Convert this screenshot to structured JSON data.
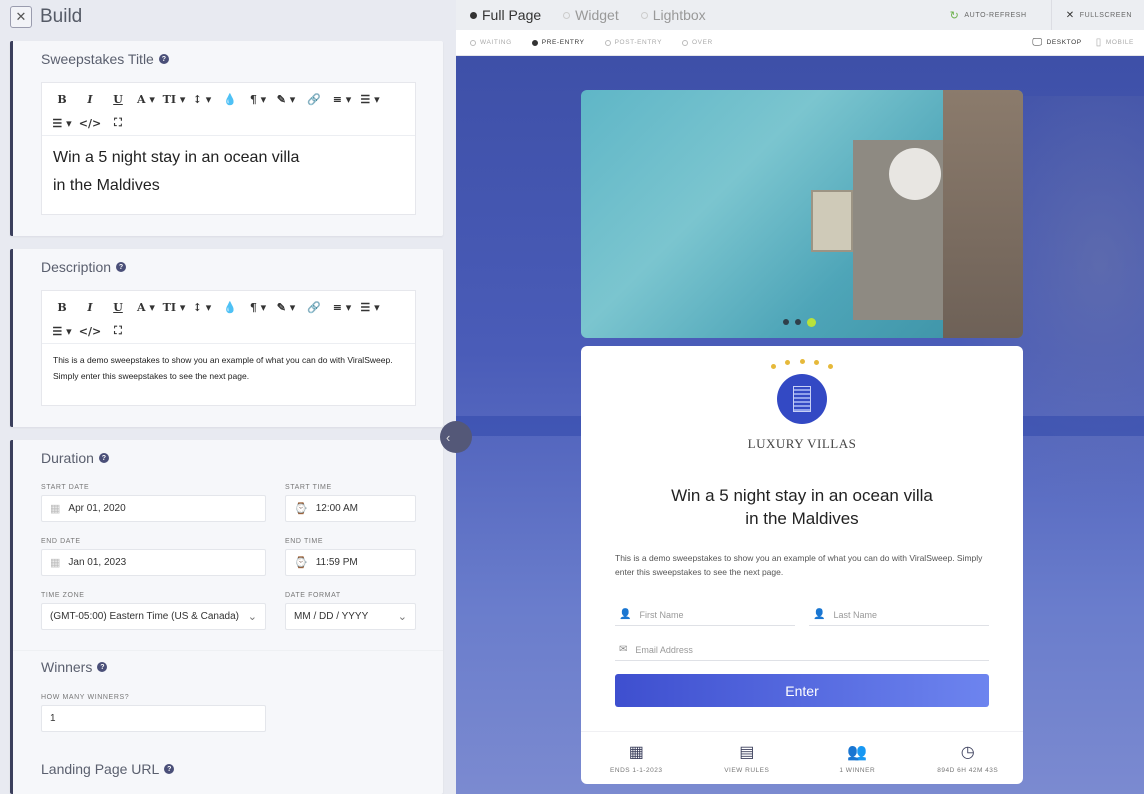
{
  "build": {
    "title": "Build",
    "icon": "tools-icon"
  },
  "title_section": {
    "label": "Sweepstakes Title",
    "toolbar": [
      "B",
      "I",
      "U",
      "A ▾",
      "TI ▾",
      "↕ ▾",
      "💧",
      "¶ ▾",
      "✎ ▾",
      "🔗",
      "≡ ▾",
      "☰ ▾",
      "☰ ▾",
      "</>",
      "⛶"
    ],
    "content_line1": "Win a 5 night stay in an ocean villa",
    "content_line2": "in the Maldives"
  },
  "description_section": {
    "label": "Description",
    "toolbar": [
      "B",
      "I",
      "U",
      "A ▾",
      "TI ▾",
      "↕ ▾",
      "💧",
      "¶ ▾",
      "✎ ▾",
      "🔗",
      "≡ ▾",
      "☰ ▾",
      "☰ ▾",
      "</>",
      "⛶"
    ],
    "content": "This is a demo sweepstakes to show you an example of what you can do with ViralSweep. Simply enter this sweepstakes to see the next page."
  },
  "duration": {
    "label": "Duration",
    "start_date_label": "Start Date",
    "start_date": "Apr 01, 2020",
    "start_time_label": "Start Time",
    "start_time": "12:00 AM",
    "end_date_label": "End Date",
    "end_date": "Jan 01, 2023",
    "end_time_label": "End Time",
    "end_time": "11:59 PM",
    "timezone_label": "Time Zone",
    "timezone": "(GMT-05:00) Eastern Time (US & Canada)",
    "date_format_label": "Date Format",
    "date_format": "MM / DD / YYYY"
  },
  "winners": {
    "label": "Winners",
    "count_label": "How many winners?",
    "count": "1"
  },
  "landing": {
    "label": "Landing Page URL"
  },
  "preview": {
    "modes": [
      "Full Page",
      "Widget",
      "Lightbox"
    ],
    "active_mode": "Full Page",
    "auto_refresh": "Auto-Refresh",
    "fullscreen": "Fullscreen",
    "states": [
      "Waiting",
      "Pre-Entry",
      "Post-Entry",
      "Over"
    ],
    "active_state": "Pre-Entry",
    "desktop": "Desktop",
    "mobile": "Mobile"
  },
  "campaign": {
    "brand": "LUXURY VILLAS",
    "headline1": "Win a 5 night stay in an ocean villa",
    "headline2": "in the Maldives",
    "description": "This is a demo sweepstakes to show you an example of what you can do with ViralSweep. Simply enter this sweepstakes to see the next page.",
    "first_name_placeholder": "First Name",
    "last_name_placeholder": "Last Name",
    "email_placeholder": "Email Address",
    "enter_label": "Enter",
    "slides": 3,
    "active_slide": 3,
    "footer": [
      {
        "icon": "calendar-icon",
        "label": "Ends 1-1-2023"
      },
      {
        "icon": "rules-icon",
        "label": "View Rules"
      },
      {
        "icon": "users-icon",
        "label": "1 Winner"
      },
      {
        "icon": "clock-icon",
        "label": "894d 6h 42m 43s"
      }
    ],
    "accent_color": "#3e4fcf"
  }
}
